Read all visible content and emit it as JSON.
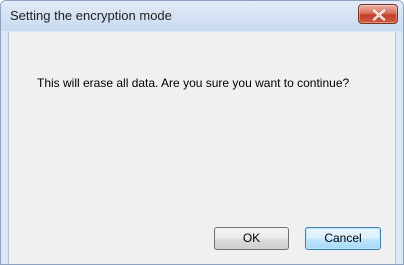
{
  "window": {
    "title": "Setting the encryption mode",
    "close_icon": "close-icon"
  },
  "dialog": {
    "message": "This will erase all data. Are you sure you want to continue?"
  },
  "buttons": {
    "ok_label": "OK",
    "cancel_label": "Cancel"
  },
  "colors": {
    "frame": "#dce7f4",
    "content_bg": "#f0f0f0",
    "close_button": "#c2402a",
    "focused_button_border": "#3c7fb1"
  }
}
